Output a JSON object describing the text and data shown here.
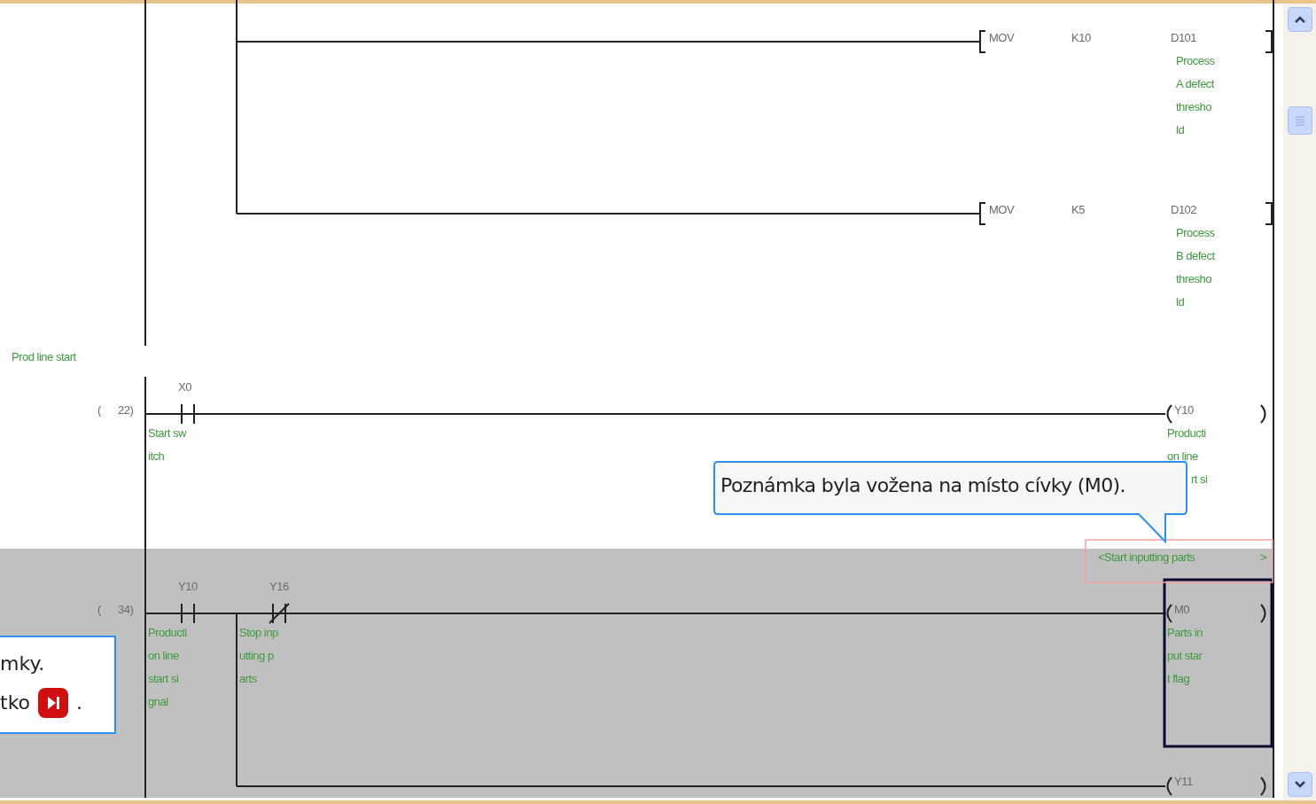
{
  "instructions": [
    {
      "mnemonic": "MOV",
      "source": "K10",
      "dest": "D101",
      "comment": [
        "Process",
        "A defect",
        "thresho",
        "ld"
      ]
    },
    {
      "mnemonic": "MOV",
      "source": "K5",
      "dest": "D102",
      "comment": [
        "Process",
        "B defect",
        "thresho",
        "ld"
      ]
    }
  ],
  "statement": "Prod line start",
  "rungs": [
    {
      "step_open": "(",
      "step": "22)",
      "highlighted": false,
      "contacts": [
        {
          "kind": "no",
          "device": "X0",
          "comment": [
            "Start sw",
            "itch"
          ]
        }
      ],
      "coil": {
        "device": "Y10",
        "comment": [
          "Producti",
          "on line",
          "rt si"
        ],
        "selected": false
      }
    },
    {
      "step_open": "(",
      "step": "34)",
      "highlighted": true,
      "note": "<Start inputting parts",
      "note_end": ">",
      "contacts": [
        {
          "kind": "no",
          "device": "Y10",
          "comment": [
            "Producti",
            "on line",
            "start si",
            "gnal"
          ]
        },
        {
          "kind": "nc",
          "device": "Y16",
          "comment": [
            "Stop inp",
            "utting p",
            "arts"
          ]
        }
      ],
      "coil": {
        "device": "M0",
        "comment": [
          "Parts in",
          "put star",
          "t flag"
        ],
        "selected": true
      },
      "branch_coil": {
        "device": "Y11"
      }
    }
  ],
  "callout": {
    "text": "Poznámka byla vožena na místo cívky (M0)."
  },
  "hint": {
    "lines": [
      "mky.",
      "tko"
    ],
    "suffix": "."
  }
}
